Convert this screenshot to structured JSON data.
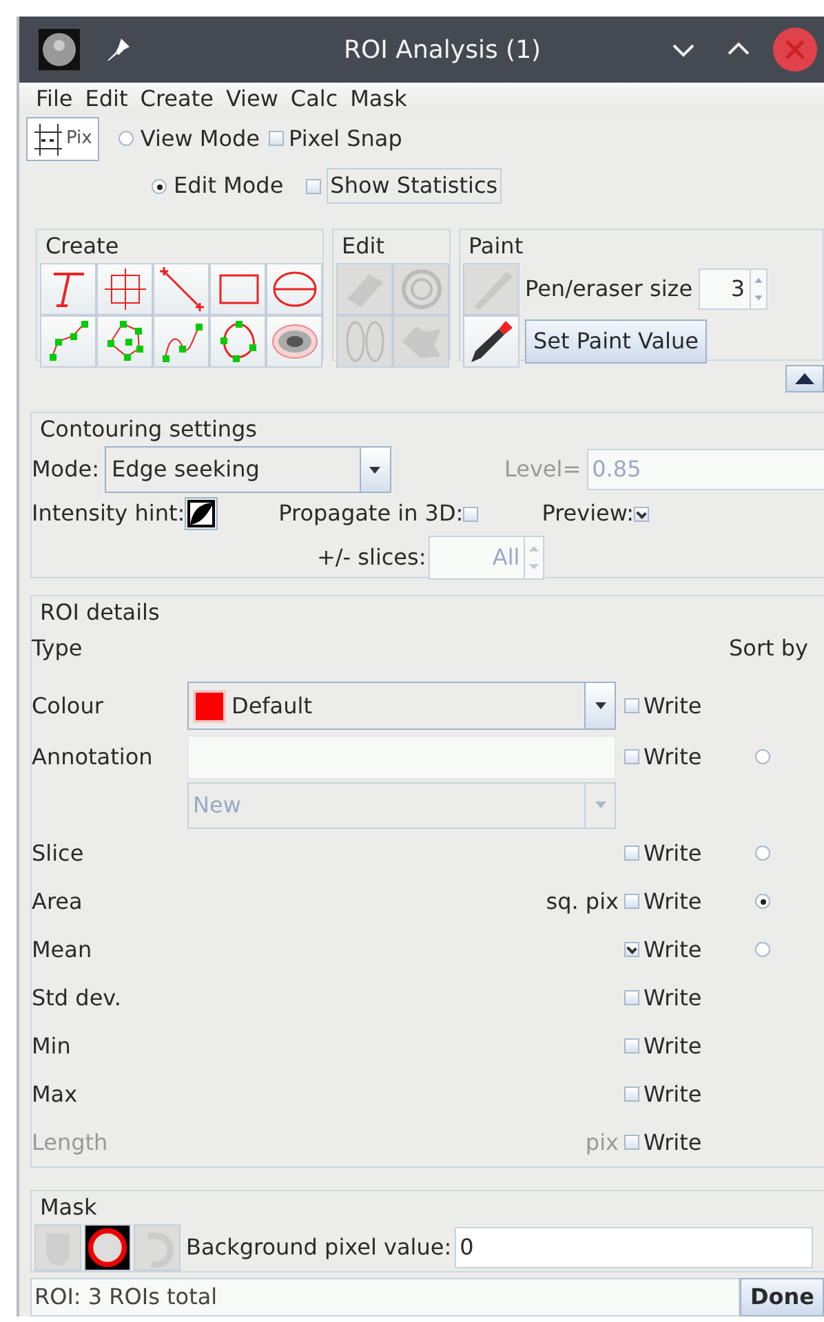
{
  "window": {
    "title": "ROI Analysis (1)"
  },
  "menu": [
    "File",
    "Edit",
    "Create",
    "View",
    "Calc",
    "Mask"
  ],
  "toolbar": {
    "pix_button": "Pix",
    "modes": [
      {
        "label": "View Mode",
        "selected": false
      },
      {
        "label": "Edit Mode",
        "selected": true
      }
    ],
    "options": [
      {
        "label": "Pixel Snap",
        "checked": false
      },
      {
        "label": "Show Statistics",
        "checked": false
      }
    ]
  },
  "create_group": {
    "title": "Create"
  },
  "edit_group": {
    "title": "Edit"
  },
  "paint_group": {
    "title": "Paint",
    "pen_label": "Pen/eraser size",
    "pen_value": "3",
    "set_button": "Set Paint Value"
  },
  "contouring": {
    "title": "Contouring settings",
    "mode_label": "Mode:",
    "mode_value": "Edge seeking",
    "level_label": "Level=",
    "level_value": "0.85",
    "intensity_label": "Intensity hint:",
    "propagate_label": "Propagate in 3D:",
    "propagate_checked": false,
    "preview_label": "Preview:",
    "preview_checked": true,
    "slices_label": "+/- slices:",
    "slices_value": "All"
  },
  "roi_details": {
    "title": "ROI details",
    "type_label": "Type",
    "sort_label": "Sort by",
    "colour": {
      "label": "Colour",
      "color": "#ff0000",
      "value": "Default",
      "write_label": "Write",
      "write": false
    },
    "annotation": {
      "label": "Annotation",
      "write_label": "Write",
      "write": false,
      "sort_selected": false,
      "new_value": "New"
    },
    "rows": [
      {
        "label": "Slice",
        "write_label": "Write",
        "write": false,
        "sort_selected": false,
        "disabled": false
      },
      {
        "label": "Area",
        "unit": "sq. pix",
        "write_label": "Write",
        "write": false,
        "sort_selected": true,
        "disabled": false
      },
      {
        "label": "Mean",
        "write_label": "Write",
        "write": true,
        "sort_selected": false,
        "disabled": false
      },
      {
        "label": "Std dev.",
        "write_label": "Write",
        "write": false,
        "disabled": false
      },
      {
        "label": "Min",
        "write_label": "Write",
        "write": false,
        "disabled": false
      },
      {
        "label": "Max",
        "write_label": "Write",
        "write": false,
        "disabled": false
      },
      {
        "label": "Length",
        "unit": "pix",
        "write_label": "Write",
        "write": false,
        "disabled": true
      }
    ]
  },
  "mask": {
    "title": "Mask",
    "bg_label": "Background pixel value:",
    "bg_value": "0"
  },
  "status_bar": {
    "text": "ROI: 3 ROIs total",
    "done_button": "Done"
  }
}
